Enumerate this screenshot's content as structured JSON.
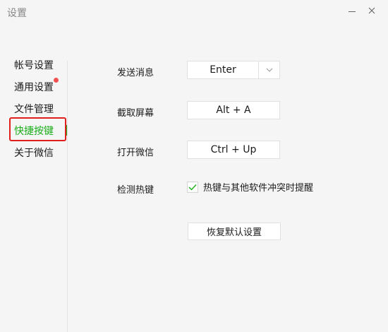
{
  "window": {
    "title": "设置"
  },
  "sidebar": {
    "items": [
      {
        "label": "帐号设置"
      },
      {
        "label": "通用设置",
        "badge_dot": true
      },
      {
        "label": "文件管理"
      },
      {
        "label": "快捷按键",
        "active": true
      },
      {
        "label": "关于微信"
      }
    ]
  },
  "shortcuts": {
    "send_message": {
      "label": "发送消息",
      "value": "Enter"
    },
    "screenshot": {
      "label": "截取屏幕",
      "value": "Alt + A"
    },
    "open_wechat": {
      "label": "打开微信",
      "value": "Ctrl + Up"
    },
    "detect_hotkey": {
      "label": "检测热键",
      "checkbox_label": "热键与其他软件冲突时提醒",
      "checked": true
    },
    "restore_default": "恢复默认设置"
  },
  "colors": {
    "accent": "#1aad19",
    "badge": "#f25150",
    "highlight": "#e0201c",
    "background": "#f5f5f5"
  },
  "icons": {
    "minimize": "minimize-icon",
    "close": "close-icon",
    "dropdown": "chevron-down-icon",
    "check": "checkmark-icon"
  }
}
